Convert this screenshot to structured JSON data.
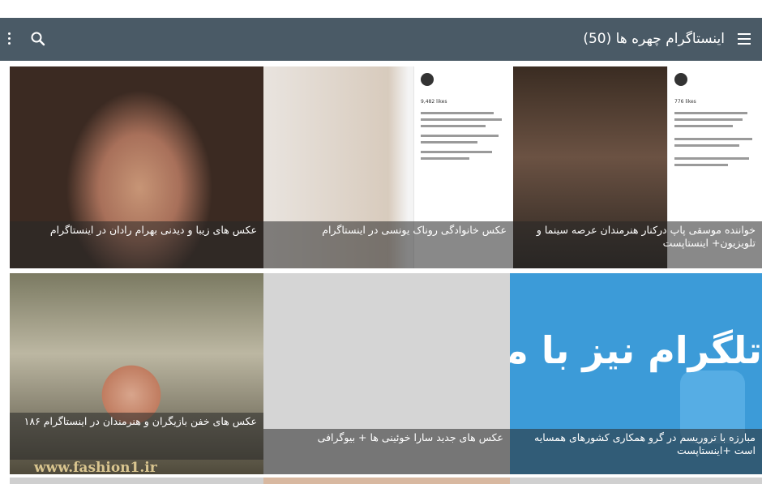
{
  "app_bar": {
    "title": "اینستاگرام چهره ها (50)",
    "menu_icon": "hamburger-menu-icon",
    "search_icon": "search-icon",
    "more_icon": "more-vert-icon",
    "background_color": "#4a5a66"
  },
  "cards": [
    {
      "caption": "عکس های زیبا و دیدنی بهرام رادان در اینستاگرام"
    },
    {
      "caption": "عکس خانوادگی روناک یونسی در اینستاگرام"
    },
    {
      "caption": "خواننده موسقی پاپ درکنار هنرمندان عرصه سینما و تلویزیون+ اینستاپست"
    },
    {
      "caption": "عکس های خفن بازیگران و هنرمندان در اینستاگرام ۱۸۶"
    },
    {
      "caption": "عکس های جدید سارا خوئینی ها + بیوگرافی"
    },
    {
      "caption": "مبارزه با تروریسم در گرو همکاری کشورهای همسایه است +اینستاپست"
    }
  ],
  "photo_overlays": {
    "likes_1": "9,482 likes",
    "likes_2": "776 likes",
    "watermark": "www.fashion1.ir",
    "telegram_banner": "تلگرام نیز با ما"
  }
}
